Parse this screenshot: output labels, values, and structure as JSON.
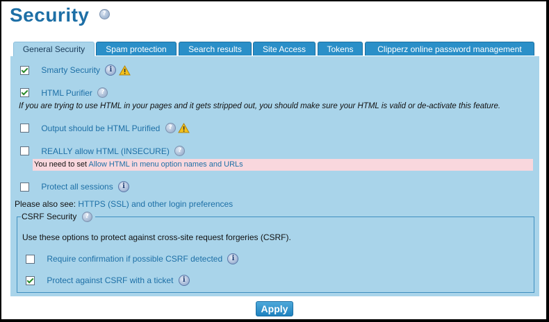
{
  "page": {
    "title": "Security"
  },
  "tabs": [
    {
      "label": "General Security",
      "active": true
    },
    {
      "label": "Spam protection"
    },
    {
      "label": "Search results"
    },
    {
      "label": "Site Access"
    },
    {
      "label": "Tokens"
    },
    {
      "label": "Clipperz online password management"
    }
  ],
  "options": {
    "smarty_security": {
      "label": "Smarty Security",
      "checked": true
    },
    "html_purifier": {
      "label": "HTML Purifier",
      "checked": true
    },
    "html_purifier_note": "If you are trying to use HTML in your pages and it gets stripped out, you should make sure your HTML is valid or de-activate this feature.",
    "output_purified": {
      "label": "Output should be HTML Purified",
      "checked": false
    },
    "really_allow_html": {
      "label": "REALLY allow HTML (INSECURE)",
      "checked": false
    },
    "alert_prefix": "You need to set",
    "alert_link": "Allow HTML in menu option names and URLs",
    "protect_sessions": {
      "label": "Protect all sessions",
      "checked": false
    }
  },
  "see_also": {
    "prefix": "Please also see:",
    "link": "HTTPS (SSL) and other login preferences"
  },
  "csrf": {
    "legend": "CSRF Security",
    "description": "Use these options to protect against cross-site request forgeries (CSRF).",
    "require_confirmation": {
      "label": "Require confirmation if possible CSRF detected",
      "checked": false
    },
    "protect_ticket": {
      "label": "Protect against CSRF with a ticket",
      "checked": true
    }
  },
  "apply_label": "Apply",
  "colors": {
    "accent": "#1d6fa6",
    "tab": "#2a8fc8",
    "panel": "#a9d4ea",
    "alert": "#f9d7dd"
  },
  "icons": {
    "help": "help-icon",
    "info": "info-icon",
    "warning": "warning-icon"
  }
}
